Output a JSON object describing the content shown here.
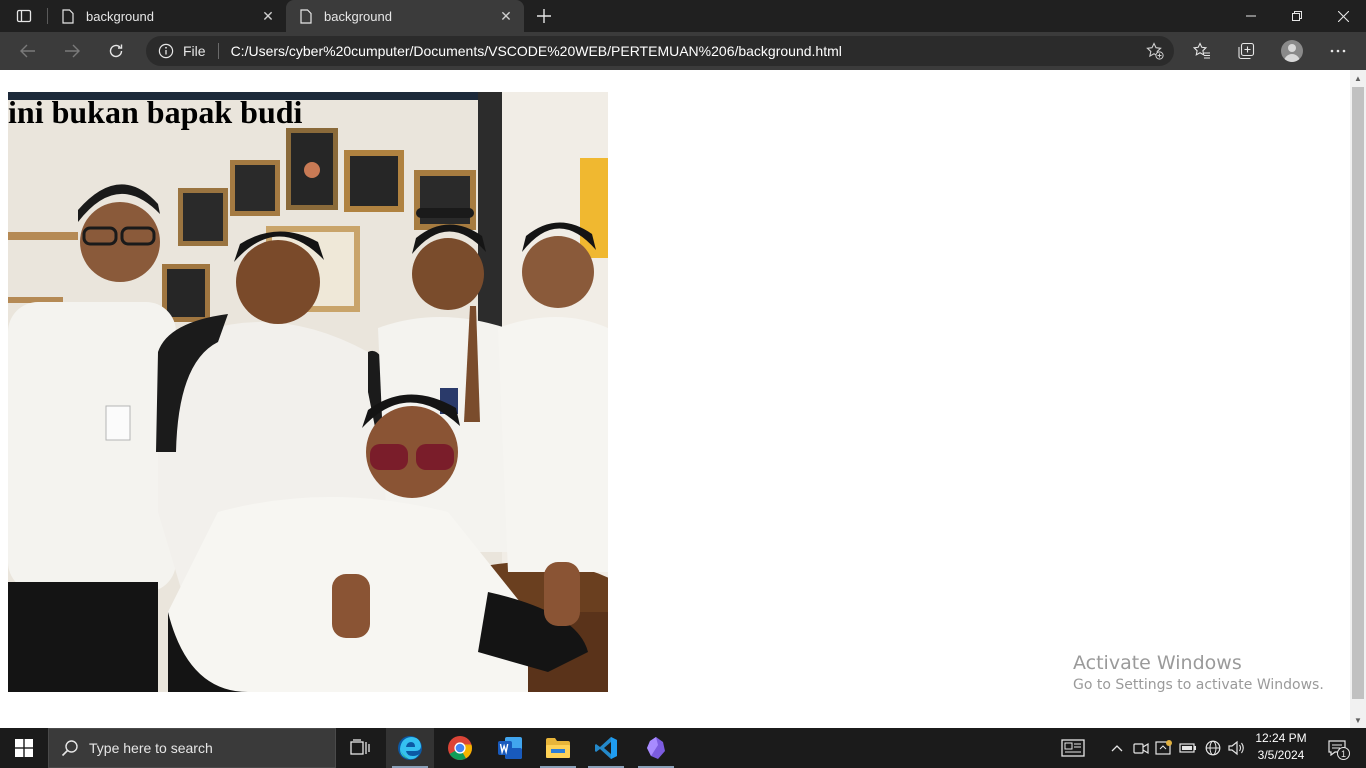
{
  "browser": {
    "tabs": [
      {
        "title": "background",
        "active": false
      },
      {
        "title": "background",
        "active": true
      }
    ],
    "address": {
      "scheme": "File",
      "url": "C:/Users/cyber%20cumputer/Documents/VSCODE%20WEB/PERTEMUAN%206/background.html"
    }
  },
  "page": {
    "heading": "ini bukan bapak budi"
  },
  "watermark": {
    "title": "Activate Windows",
    "subtitle": "Go to Settings to activate Windows."
  },
  "taskbar": {
    "search_placeholder": "Type here to search",
    "apps": [
      "task-view",
      "edge",
      "chrome",
      "word",
      "file-explorer",
      "vscode",
      "obsidian"
    ],
    "active_app": "edge",
    "clock_time": "12:24 PM",
    "clock_date": "3/5/2024",
    "notification_count": "1"
  },
  "colors": {
    "titlebar": "#202020",
    "toolbar": "#3b3b3b",
    "taskbar": "#1b1b1b"
  }
}
